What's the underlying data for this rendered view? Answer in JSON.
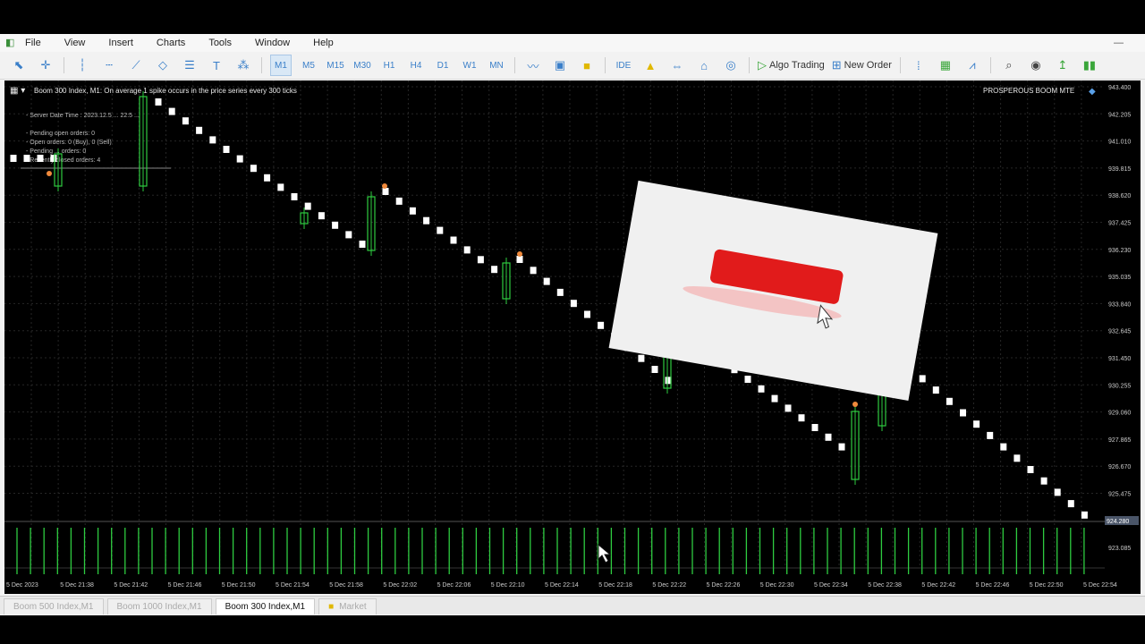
{
  "menu": {
    "items": [
      "File",
      "View",
      "Insert",
      "Charts",
      "Tools",
      "Window",
      "Help"
    ]
  },
  "toolbar": {
    "timeframes": [
      "M1",
      "M5",
      "M15",
      "M30",
      "H1",
      "H4",
      "D1",
      "W1",
      "MN"
    ],
    "active_timeframe": "M1",
    "ide_label": "IDE",
    "algo_trading_label": "Algo Trading",
    "new_order_label": "New Order"
  },
  "chart": {
    "header_title": "Boom 300 Index, M1:  On average 1 spike occurs in the price series every 300 ticks",
    "ea_name": "PROSPEROUS BOOM MTE",
    "overlay_lines": [
      "- Server Date Time : 2023.12.5 ... 22:5 ...",
      "- Pending open orders: 0",
      "- Open orders: 0 (Buy), 0 (Sell)",
      "- Pending ... orders: 0",
      "- Recently closed orders: 4"
    ],
    "price_labels": [
      "943.400",
      "942.205",
      "941.010",
      "939.815",
      "938.620",
      "937.425",
      "936.230",
      "935.035",
      "933.840",
      "932.645",
      "931.450",
      "930.255",
      "929.060",
      "927.865",
      "926.670",
      "925.475"
    ],
    "current_price": "924.280",
    "volume_label": "923.085",
    "time_labels": [
      "5 Dec 2023",
      "5 Dec 21:38",
      "5 Dec 21:42",
      "5 Dec 21:46",
      "5 Dec 21:50",
      "5 Dec 21:54",
      "5 Dec 21:58",
      "5 Dec 22:02",
      "5 Dec 22:06",
      "5 Dec 22:10",
      "5 Dec 22:14",
      "5 Dec 22:18",
      "5 Dec 22:22",
      "5 Dec 22:26",
      "5 Dec 22:30",
      "5 Dec 22:34",
      "5 Dec 22:38",
      "5 Dec 22:42",
      "5 Dec 22:46",
      "5 Dec 22:50",
      "5 Dec 22:54"
    ]
  },
  "tabs": [
    {
      "label": "Boom 500 Index,M1",
      "active": false
    },
    {
      "label": "Boom 1000 Index,M1",
      "active": false
    },
    {
      "label": "Boom 300 Index,M1",
      "active": true
    },
    {
      "label": "Market",
      "active": false
    }
  ],
  "colors": {
    "bull": "#2ecc40",
    "bear": "#ffffff",
    "grid": "#2a2a2a",
    "popup_button": "#e11b1b"
  }
}
